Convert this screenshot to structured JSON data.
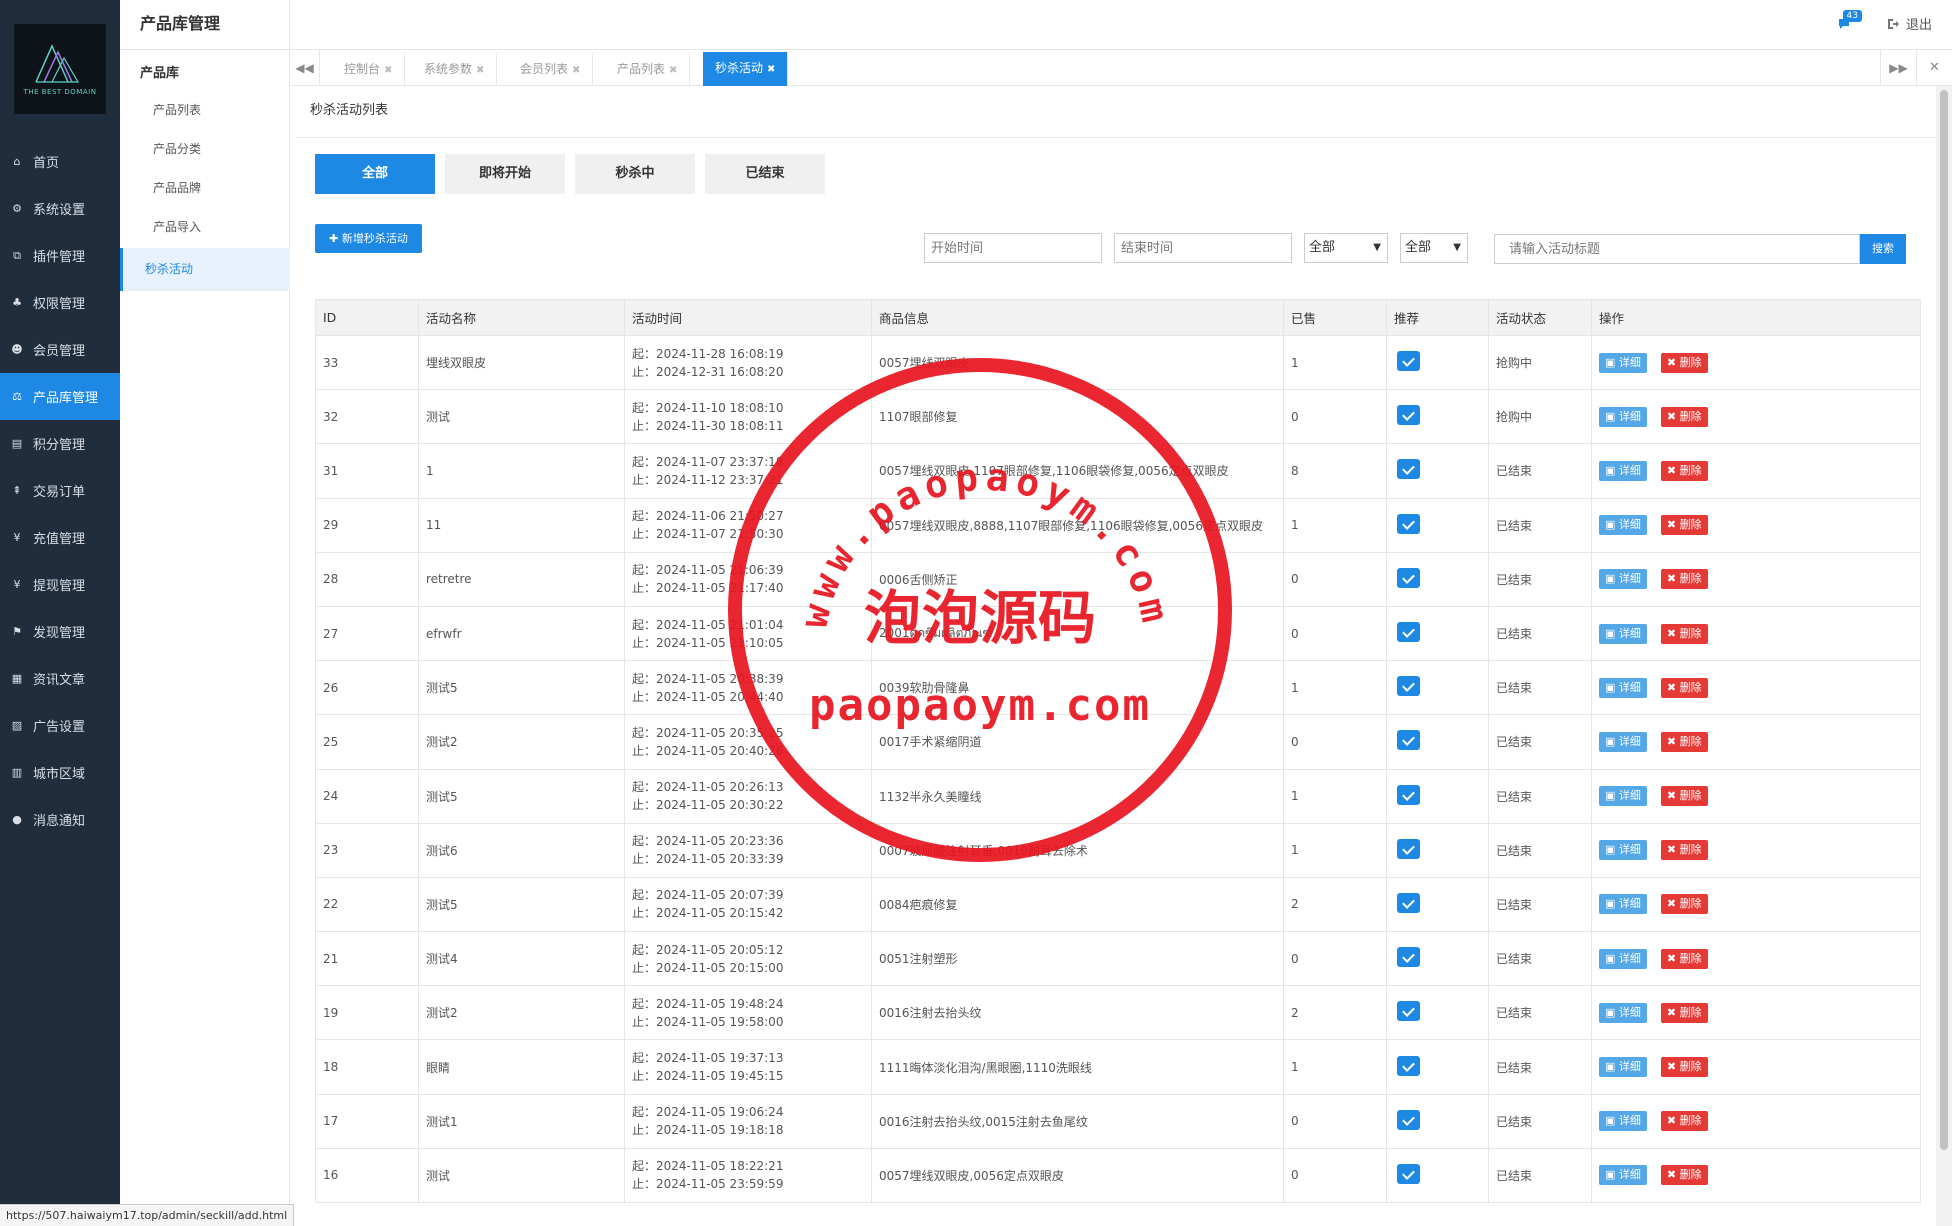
{
  "logo": {
    "text": "THE BEST DOMAIN"
  },
  "nav": [
    {
      "label": "首页",
      "icon": "home-icon",
      "glyph": "⌂"
    },
    {
      "label": "系统设置",
      "icon": "gear-icon",
      "glyph": "⚙"
    },
    {
      "label": "插件管理",
      "icon": "plugin-icon",
      "glyph": "⧉"
    },
    {
      "label": "权限管理",
      "icon": "sitemap-icon",
      "glyph": "♣"
    },
    {
      "label": "会员管理",
      "icon": "users-icon",
      "glyph": "☻"
    },
    {
      "label": "产品库管理",
      "icon": "balance-icon",
      "glyph": "⚖"
    },
    {
      "label": "积分管理",
      "icon": "document-icon",
      "glyph": "▤"
    },
    {
      "label": "交易订单",
      "icon": "signpost-icon",
      "glyph": "⇞"
    },
    {
      "label": "充值管理",
      "icon": "yen-icon",
      "glyph": "¥"
    },
    {
      "label": "提现管理",
      "icon": "yen-icon",
      "glyph": "¥"
    },
    {
      "label": "发现管理",
      "icon": "flag-icon",
      "glyph": "⚑"
    },
    {
      "label": "资讯文章",
      "icon": "newspaper-icon",
      "glyph": "▦"
    },
    {
      "label": "广告设置",
      "icon": "image-icon",
      "glyph": "▨"
    },
    {
      "label": "城市区域",
      "icon": "map-icon",
      "glyph": "▥"
    },
    {
      "label": "消息通知",
      "icon": "chat-icon",
      "glyph": "●"
    }
  ],
  "subnav": {
    "title": "产品库管理",
    "group": "产品库",
    "items": [
      "产品列表",
      "产品分类",
      "产品品牌",
      "产品导入",
      "秒杀活动"
    ]
  },
  "topbar": {
    "badge": "43",
    "logout": "退出"
  },
  "tabs": [
    "控制台",
    "系统参数",
    "会员列表",
    "产品列表",
    "秒杀活动"
  ],
  "panel": {
    "title": "秒杀活动列表"
  },
  "filters": [
    "全部",
    "即将开始",
    "秒杀中",
    "已结束"
  ],
  "toolbar": {
    "add_label": "✚ 新增秒杀活动",
    "start_placeholder": "开始时间",
    "end_placeholder": "结束时间",
    "select1": "全部",
    "select2": "全部",
    "search_placeholder": "请输入活动标题",
    "search_label": "搜索"
  },
  "table": {
    "headers": [
      "ID",
      "活动名称",
      "活动时间",
      "商品信息",
      "已售",
      "推荐",
      "活动状态",
      "操作"
    ],
    "detail_label": "详细",
    "delete_label": "删除",
    "rows": [
      {
        "id": "33",
        "name": "埋线双眼皮",
        "start": "起：2024-11-28 16:08:19",
        "end": "止：2024-12-31 16:08:20",
        "goods": "0057埋线双眼皮",
        "sold": "1",
        "status": "抢购中"
      },
      {
        "id": "32",
        "name": "测试",
        "start": "起：2024-11-10 18:08:10",
        "end": "止：2024-11-30 18:08:11",
        "goods": "1107眼部修复",
        "sold": "0",
        "status": "抢购中"
      },
      {
        "id": "31",
        "name": "1",
        "start": "起：2024-11-07 23:37:18",
        "end": "止：2024-11-12 23:37:21",
        "goods": "0057埋线双眼皮,1107眼部修复,1106眼袋修复,0056定点双眼皮",
        "sold": "8",
        "status": "已结束"
      },
      {
        "id": "29",
        "name": "11",
        "start": "起：2024-11-06 21:50:27",
        "end": "止：2024-11-07 21:50:30",
        "goods": "0057埋线双眼皮,8888,1107眼部修复,1106眼袋修复,0056定点双眼皮",
        "sold": "1",
        "status": "已结束"
      },
      {
        "id": "28",
        "name": "retretre",
        "start": "起：2024-11-05 21:06:39",
        "end": "止：2024-11-05 21:17:40",
        "goods": "0006舌侧矫正",
        "sold": "0",
        "status": "已结束"
      },
      {
        "id": "27",
        "name": "efrwfr",
        "start": "起：2024-11-05 21:01:04",
        "end": "止：2024-11-05 21:10:05",
        "goods": "2001ดูดซึมผลิตภัณฑ์",
        "sold": "0",
        "status": "已结束"
      },
      {
        "id": "26",
        "name": "测试5",
        "start": "起：2024-11-05 20:38:39",
        "end": "止：2024-11-05 20:44:40",
        "goods": "0039软肋骨隆鼻",
        "sold": "1",
        "status": "已结束"
      },
      {
        "id": "25",
        "name": "测试2",
        "start": "起：2024-11-05 20:35:25",
        "end": "止：2024-11-05 20:40:26",
        "goods": "0017手术紧缩阴道",
        "sold": "0",
        "status": "已结束"
      },
      {
        "id": "24",
        "name": "测试5",
        "start": "起：2024-11-05 20:26:13",
        "end": "止：2024-11-05 20:30:22",
        "goods": "1132半永久美瞳线",
        "sold": "1",
        "status": "已结束"
      },
      {
        "id": "23",
        "name": "测试6",
        "start": "起：2024-11-05 20:23:36",
        "end": "止：2024-11-05 20:33:39",
        "goods": "0007玻尿酸注射耳垂,0010副耳去除术",
        "sold": "1",
        "status": "已结束"
      },
      {
        "id": "22",
        "name": "测试5",
        "start": "起：2024-11-05 20:07:39",
        "end": "止：2024-11-05 20:15:42",
        "goods": "0084疤痕修复",
        "sold": "2",
        "status": "已结束"
      },
      {
        "id": "21",
        "name": "测试4",
        "start": "起：2024-11-05 20:05:12",
        "end": "止：2024-11-05 20:15:00",
        "goods": "0051注射塑形",
        "sold": "0",
        "status": "已结束"
      },
      {
        "id": "19",
        "name": "测试2",
        "start": "起：2024-11-05 19:48:24",
        "end": "止：2024-11-05 19:58:00",
        "goods": "0016注射去抬头纹",
        "sold": "2",
        "status": "已结束"
      },
      {
        "id": "18",
        "name": "眼睛",
        "start": "起：2024-11-05 19:37:13",
        "end": "止：2024-11-05 19:45:15",
        "goods": "1111晦体淡化泪沟/黑眼圈,1110洗眼线",
        "sold": "1",
        "status": "已结束"
      },
      {
        "id": "17",
        "name": "测试1",
        "start": "起：2024-11-05 19:06:24",
        "end": "止：2024-11-05 19:18:18",
        "goods": "0016注射去抬头纹,0015注射去鱼尾纹",
        "sold": "0",
        "status": "已结束"
      },
      {
        "id": "16",
        "name": "测试",
        "start": "起：2024-11-05 18:22:21",
        "end": "止：2024-11-05 23:59:59",
        "goods": "0057埋线双眼皮,0056定点双眼皮",
        "sold": "0",
        "status": "已结束"
      }
    ]
  },
  "statusbar": {
    "url": "https://507.haiwaiym17.top/admin/seckill/add.html"
  },
  "watermark": {
    "arc_text": "www.paopaoym.com",
    "center_text": "泡泡源码",
    "bottom_text": "paopaoym.com"
  },
  "colors": {
    "primary": "#1e88e5",
    "danger": "#e53935",
    "sidebar": "#1f2d3d",
    "stamp": "#e8141e"
  }
}
